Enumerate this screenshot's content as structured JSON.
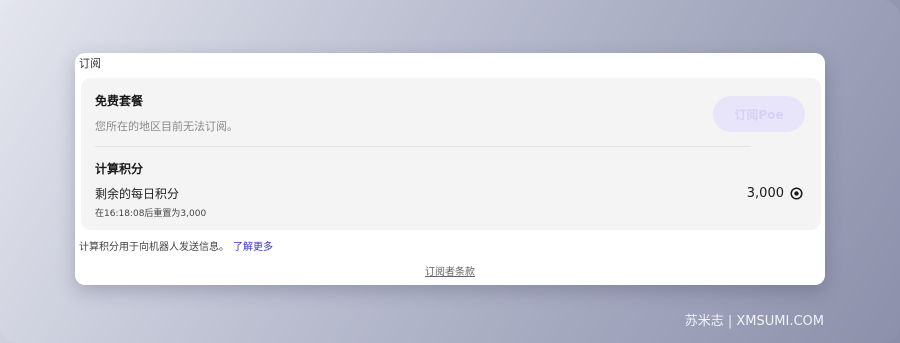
{
  "card": {
    "title": "订阅"
  },
  "plan": {
    "name": "免费套餐",
    "description": "您所在的地区目前无法订阅。",
    "subscribe_label": "订阅Poe"
  },
  "credits": {
    "title": "计算积分",
    "remaining_label": "剩余的每日积分",
    "reset_note": "在16:18:08后重置为3,000",
    "value": "3,000",
    "icon": "credit-coin-icon"
  },
  "footer": {
    "note": "计算积分用于向机器人发送信息。",
    "learn_more": "了解更多",
    "terms": "订阅者条款"
  },
  "watermark": "苏米志 | XMSUMI.COM",
  "colors": {
    "accent": "#3a33c9",
    "button_disabled_bg": "#e8e5fb"
  }
}
